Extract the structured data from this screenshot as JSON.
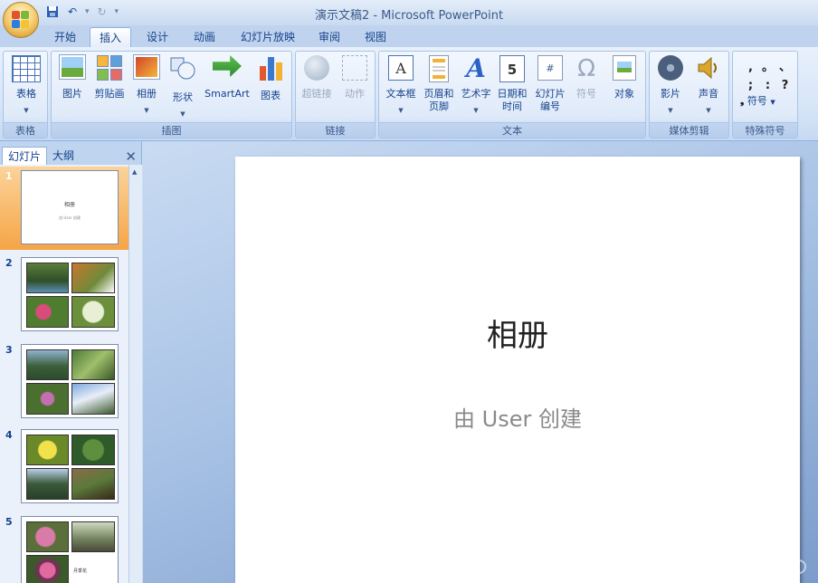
{
  "window": {
    "title": "演示文稿2 - Microsoft PowerPoint"
  },
  "tabs": [
    "开始",
    "插入",
    "设计",
    "动画",
    "幻灯片放映",
    "审阅",
    "视图"
  ],
  "ribbon": {
    "groups": [
      "表格",
      "插图",
      "链接",
      "文本",
      "媒体剪辑",
      "特殊符号"
    ],
    "buttons": {
      "table": "表格",
      "picture": "图片",
      "clipart": "剪贴画",
      "album": "相册",
      "shapes": "形状",
      "smartart": "SmartArt",
      "chart": "图表",
      "hyperlink": "超链接",
      "action": "动作",
      "textbox": "文本框",
      "header_l1": "页眉和",
      "header_l2": "页脚",
      "wordart": "艺术字",
      "date_l1": "日期和",
      "date_l2": "时间",
      "slnum_l1": "幻灯片",
      "slnum_l2": "编号",
      "symbol": "符号",
      "object": "对象",
      "movie": "影片",
      "sound": "声音",
      "special_symbol": "符号"
    },
    "date_icon_text": "5",
    "slnum_icon_text": "#",
    "textbox_icon_text": "A",
    "wordart_icon_text": "A",
    "omega": "Ω",
    "special_chars": [
      ",",
      "。",
      "、",
      ";",
      ":",
      "?"
    ]
  },
  "panel": {
    "tabs": [
      "幻灯片",
      "大纲"
    ],
    "close": "✕",
    "slides": [
      {
        "num": "1",
        "title": "相册",
        "subtitle": "由 User 创建"
      },
      {
        "num": "2"
      },
      {
        "num": "3"
      },
      {
        "num": "4"
      },
      {
        "num": "5",
        "caption": "月季花"
      }
    ]
  },
  "slide": {
    "title": "相册",
    "subtitle": "由 User 创建"
  },
  "colors": {
    "ribbon_text": "#15428b",
    "active_thumb": "#f6a546",
    "accent": "#8db2e3"
  }
}
